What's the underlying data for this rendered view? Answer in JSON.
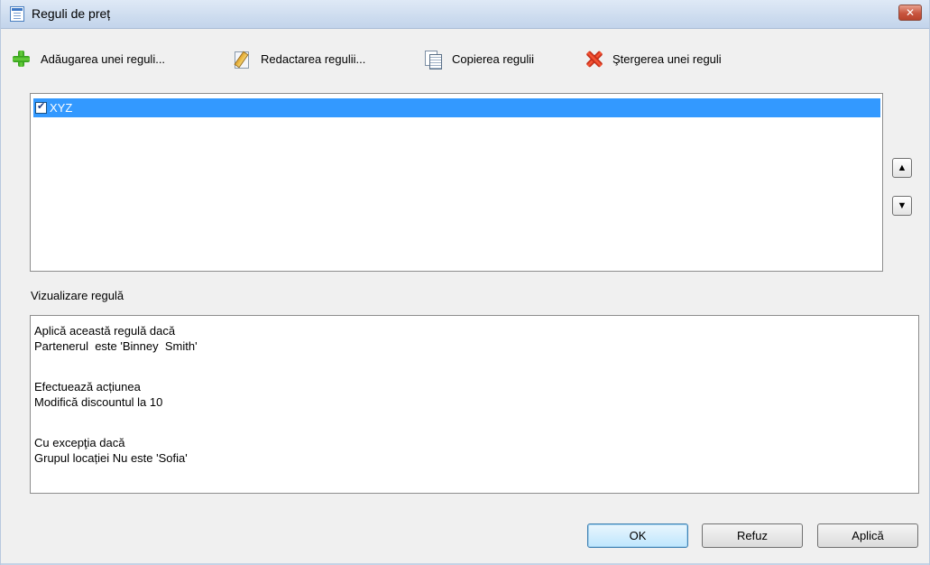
{
  "window": {
    "title": "Reguli de preț",
    "close_icon": "close-icon"
  },
  "toolbar": {
    "add_label": "Adăugarea unei reguli...",
    "edit_label": "Redactarea regulii...",
    "copy_label": "Copierea regulii",
    "delete_label": "Ştergerea unei reguli"
  },
  "rules": {
    "items": [
      {
        "label": "XYZ",
        "checked": true,
        "selected": true
      }
    ],
    "move_up_glyph": "▲",
    "move_down_glyph": "▼"
  },
  "preview": {
    "label": "Vizualizare regulă",
    "lines": [
      "Aplică această regulă dacă",
      "Partenerul  este 'Binney  Smith'",
      "",
      "Efectuează acțiunea",
      "Modifică discountul la 10",
      "",
      "Cu excepţia dacă",
      "Grupul locației Nu este 'Sofia'"
    ]
  },
  "buttons": {
    "ok": "OK",
    "cancel": "Refuz",
    "apply": "Aplică"
  },
  "colors": {
    "selection": "#3399ff",
    "window_bg": "#f0f0f0",
    "close_button": "#c8553f"
  }
}
